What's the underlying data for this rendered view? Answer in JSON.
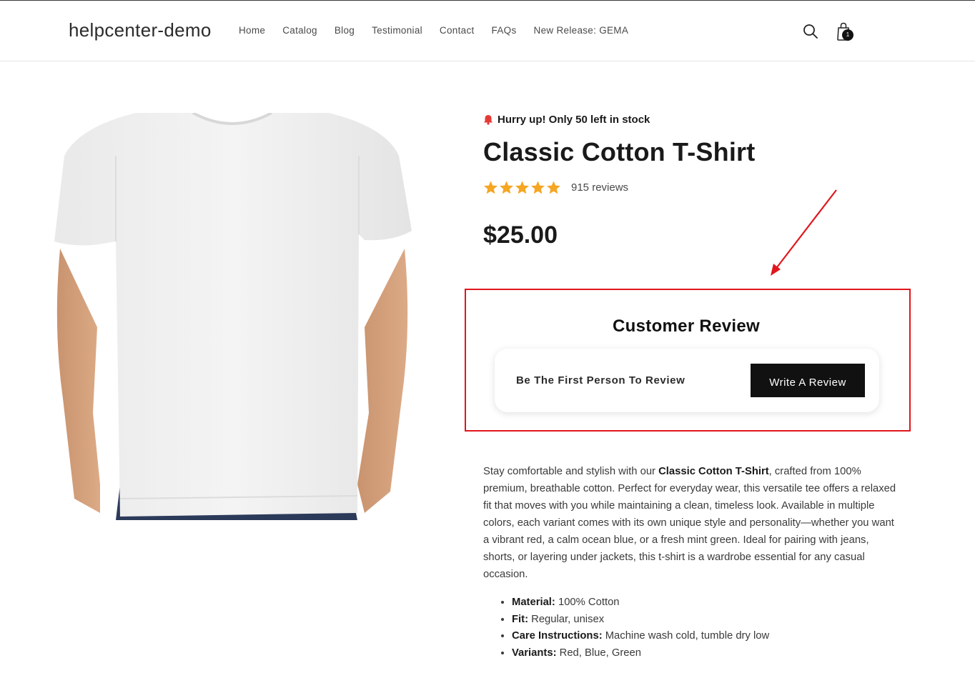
{
  "header": {
    "brand": "helpcenter-demo",
    "nav": [
      "Home",
      "Catalog",
      "Blog",
      "Testimonial",
      "Contact",
      "FAQs",
      "New Release: GEMA"
    ],
    "cart_count": "1"
  },
  "product": {
    "stock_notice": "Hurry up! Only 50 left in stock",
    "title": "Classic Cotton T-Shirt",
    "rating_stars": 5,
    "reviews_count": "915 reviews",
    "price": "$25.00"
  },
  "customer_review": {
    "heading": "Customer Review",
    "empty_text": "Be The First Person To Review",
    "write_button": "Write A Review"
  },
  "description": {
    "intro_before": "Stay comfortable and stylish with our ",
    "intro_bold": "Classic Cotton T-Shirt",
    "intro_after": ", crafted from 100% premium, breathable cotton. Perfect for everyday wear, this versatile tee offers a relaxed fit that moves with you while maintaining a clean, timeless look. Available in multiple colors, each variant comes with its own unique style and personality—whether you want a vibrant red, a calm ocean blue, or a fresh mint green. Ideal for pairing with jeans, shorts, or layering under jackets, this t-shirt is a wardrobe essential for any casual occasion.",
    "specs": [
      {
        "label": "Material:",
        "value": " 100% Cotton"
      },
      {
        "label": "Fit:",
        "value": " Regular, unisex"
      },
      {
        "label": "Care Instructions:",
        "value": " Machine wash cold, tumble dry low"
      },
      {
        "label": "Variants:",
        "value": " Red, Blue, Green"
      }
    ]
  },
  "colors": {
    "star": "#f5a623",
    "annotation": "#e0161c",
    "button_bg": "#111111",
    "bell": "#e53935"
  },
  "icons": [
    "search-icon",
    "cart-icon",
    "bell-icon",
    "star-icon"
  ]
}
